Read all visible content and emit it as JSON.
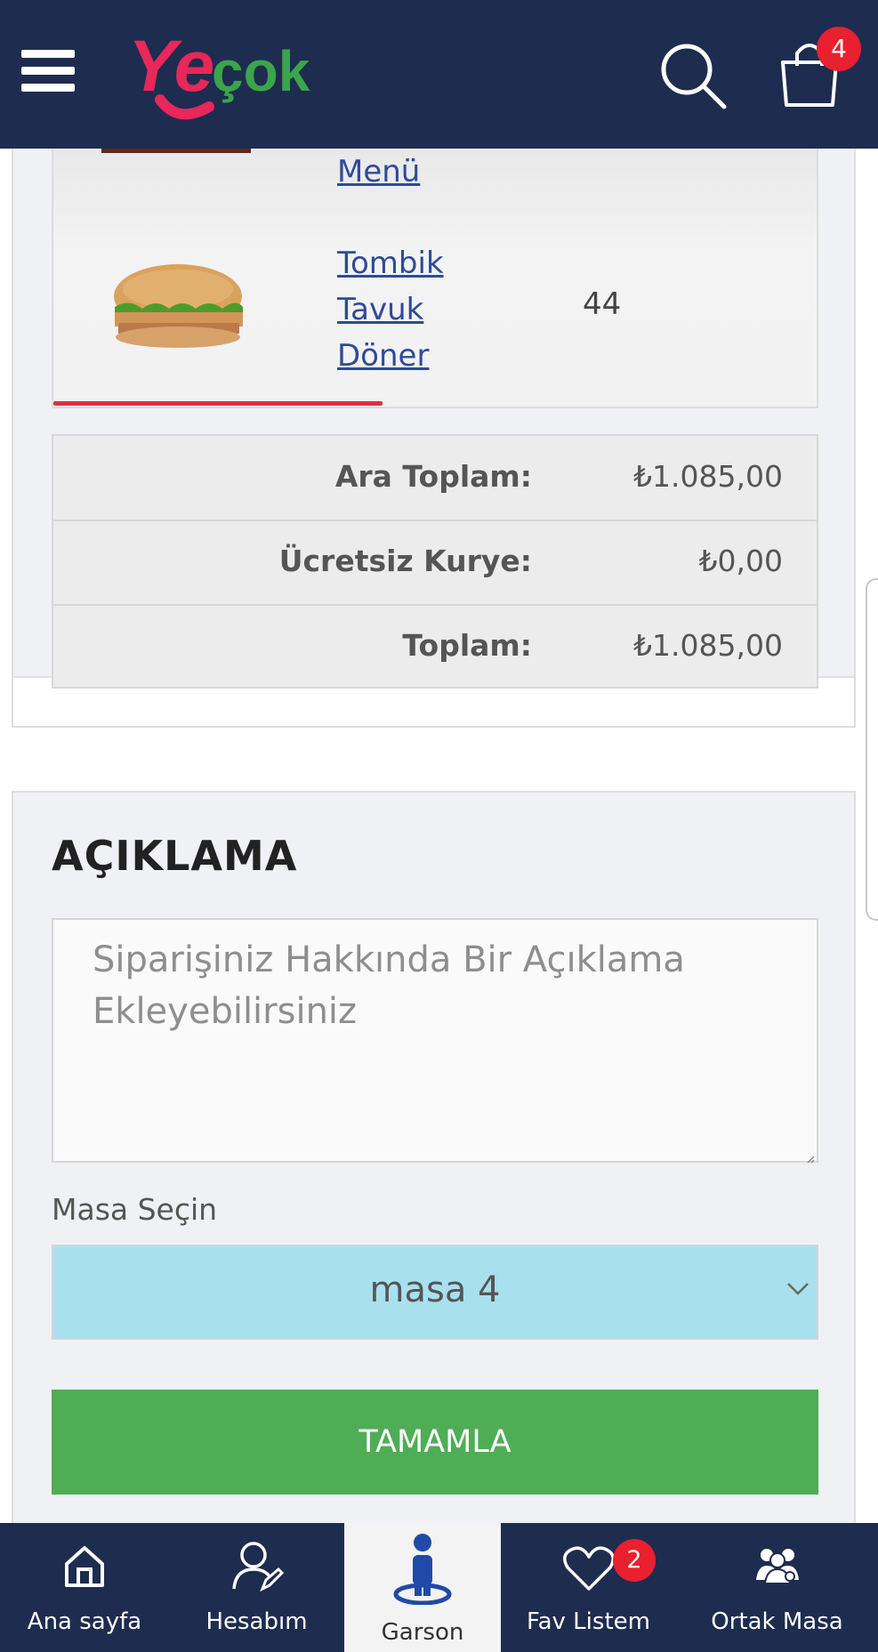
{
  "header": {
    "logo_text": "Yeçok",
    "cart_count": "4",
    "colors": {
      "bg": "#1e2c4f",
      "badge": "#e8202f"
    }
  },
  "order": {
    "items": [
      {
        "name": "Menü",
        "image": "menu-image",
        "qty": ""
      },
      {
        "name_lines": [
          "Tombik",
          "Tavuk",
          "Döner"
        ],
        "image": "burger-image",
        "qty": "44"
      }
    ],
    "totals": [
      {
        "label": "Ara Toplam:",
        "value": "₺1.085,00"
      },
      {
        "label": "Ücretsiz Kurye:",
        "value": "₺0,00"
      },
      {
        "label": "Toplam:",
        "value": "₺1.085,00"
      }
    ]
  },
  "description": {
    "title": "AÇIKLAMA",
    "placeholder": "Siparişiniz Hakkında Bir Açıklama Ekleyebilirsiniz",
    "masa_label": "Masa Seçin",
    "masa_selected": "masa 4",
    "submit_label": "TAMAMLA"
  },
  "bottom_nav": {
    "items": [
      {
        "label": "Ana sayfa",
        "icon": "home-icon"
      },
      {
        "label": "Hesabım",
        "icon": "user-edit-icon"
      },
      {
        "label": "Garson",
        "icon": "waiter-icon",
        "active": true
      },
      {
        "label": "Fav Listem",
        "icon": "heart-icon",
        "badge": "2"
      },
      {
        "label": "Ortak Masa",
        "icon": "group-icon"
      }
    ]
  }
}
